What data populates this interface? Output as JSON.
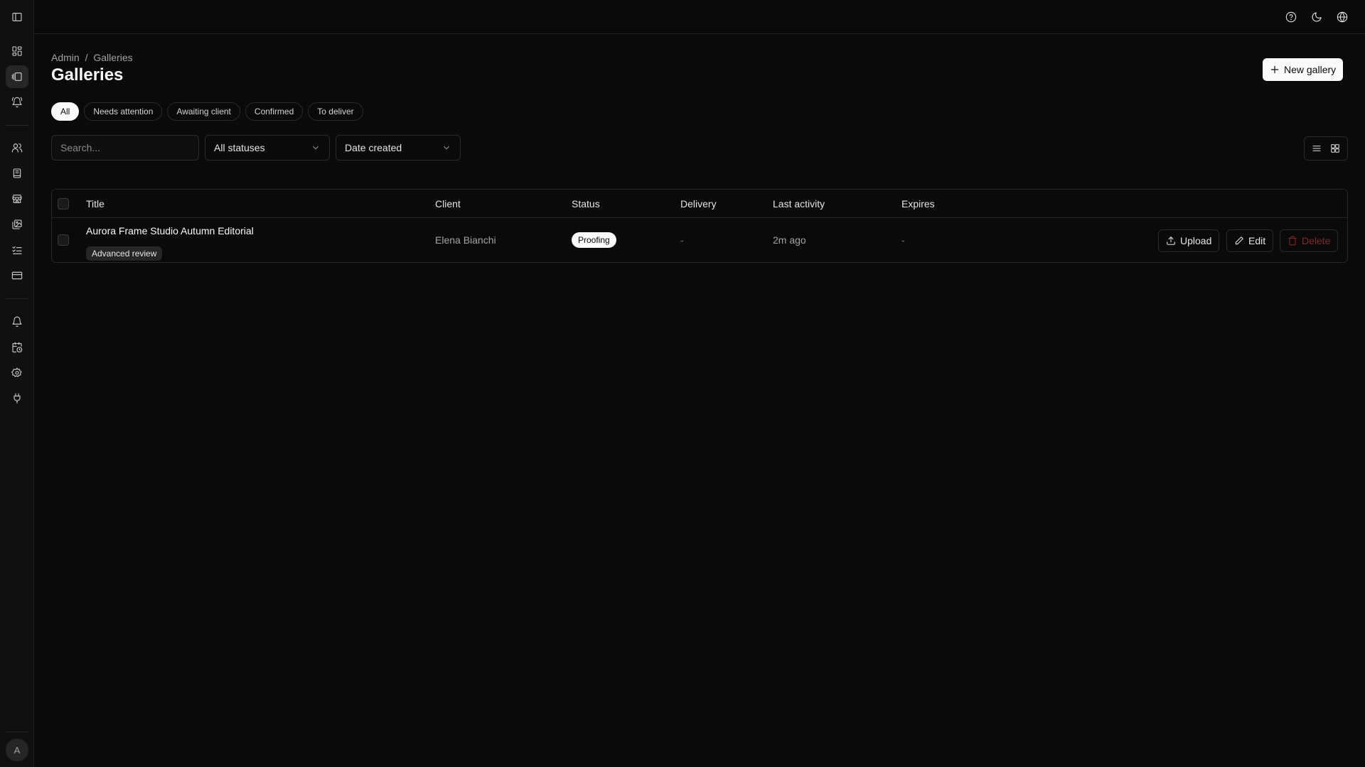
{
  "nav": {
    "items": [
      {
        "icon": "sidebar-toggle-icon"
      },
      {
        "icon": "dashboard-icon"
      },
      {
        "icon": "galleries-icon",
        "active": true
      },
      {
        "icon": "bell-ringing-icon"
      },
      {
        "icon": "users-icon"
      },
      {
        "icon": "book-icon"
      },
      {
        "icon": "store-icon"
      },
      {
        "icon": "images-icon"
      },
      {
        "icon": "checklist-icon"
      },
      {
        "icon": "credit-card-icon"
      },
      {
        "icon": "bell-icon"
      },
      {
        "icon": "calendar-clock-icon"
      },
      {
        "icon": "settings-icon"
      },
      {
        "icon": "plug-icon"
      }
    ],
    "avatar_initial": "A"
  },
  "topbar": {
    "icons": [
      "help-circle-icon",
      "moon-icon",
      "globe-icon"
    ]
  },
  "breadcrumb": {
    "root": "Admin",
    "separator": "/",
    "current": "Galleries"
  },
  "page": {
    "title": "Galleries",
    "new_button": "New gallery"
  },
  "filters": {
    "pills": [
      "All",
      "Needs attention",
      "Awaiting client",
      "Confirmed",
      "To deliver"
    ],
    "active_pill": "All",
    "search_placeholder": "Search...",
    "status_select": "All statuses",
    "sort_select": "Date created"
  },
  "table": {
    "columns": [
      "Title",
      "Client",
      "Status",
      "Delivery",
      "Last activity",
      "Expires"
    ],
    "rows": [
      {
        "title": "Aurora Frame Studio Autumn Editorial",
        "tag": "Advanced review",
        "client": "Elena Bianchi",
        "status": "Proofing",
        "delivery": "-",
        "last_activity": "2m ago",
        "expires": "-",
        "actions": {
          "upload": "Upload",
          "edit": "Edit",
          "delete": "Delete"
        }
      }
    ]
  },
  "colors": {
    "background": "#0a0a0a",
    "surface": "#101010",
    "border": "#262626",
    "primary_button": "#fafafa",
    "danger_muted": "#7f2a2a"
  }
}
